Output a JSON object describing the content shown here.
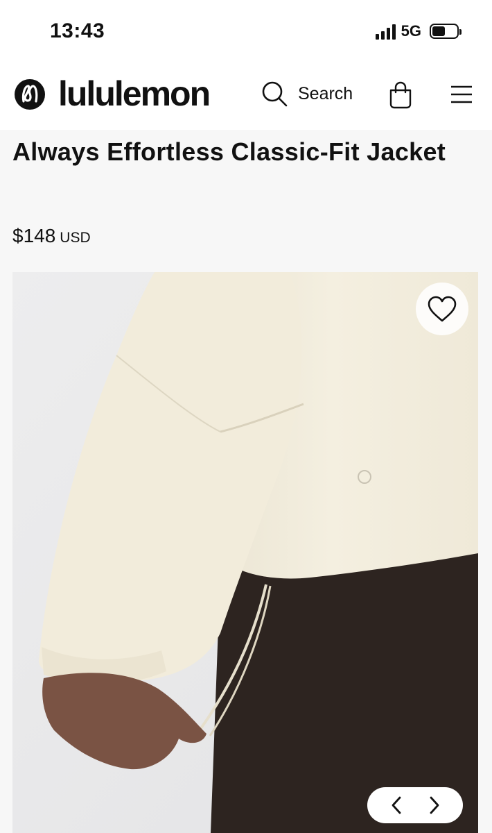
{
  "status": {
    "time": "13:43",
    "network": "5G"
  },
  "header": {
    "brand": "lululemon",
    "search_label": "Search"
  },
  "product": {
    "title": "Always Effortless Classic-Fit Jacket",
    "price": "$148",
    "currency": "USD"
  },
  "icons": {
    "logo": "lululemon-logo-icon",
    "search": "search-icon",
    "bag": "shopping-bag-icon",
    "menu": "hamburger-menu-icon",
    "wishlist": "heart-icon",
    "prev": "chevron-left-icon",
    "next": "chevron-right-icon"
  },
  "colors": {
    "page_bg": "#f7f7f7",
    "jacket": "#f1ecdc",
    "pants": "#2d2420"
  }
}
